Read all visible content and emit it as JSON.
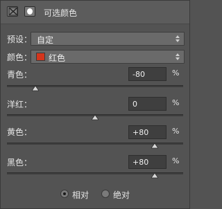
{
  "header": {
    "title": "可选颜色",
    "adjustment_icon": "selective-color-adjustment-icon",
    "mask_icon": "layer-mask-icon"
  },
  "preset": {
    "label": "预设：",
    "value": "自定"
  },
  "colors": {
    "label": "颜色：",
    "value": "红色",
    "swatch_color": "#d4351c"
  },
  "sliders": [
    {
      "label": "青色：",
      "value": "-80",
      "unit": "%",
      "level": -80
    },
    {
      "label": "洋红：",
      "value": "0",
      "unit": "%",
      "level": 0
    },
    {
      "label": "黄色：",
      "value": "+80",
      "unit": "%",
      "level": 80
    },
    {
      "label": "黑色：",
      "value": "+80",
      "unit": "%",
      "level": 80
    }
  ],
  "method": {
    "options": [
      {
        "label": "相对",
        "checked": true
      },
      {
        "label": "绝对",
        "checked": false
      }
    ]
  }
}
